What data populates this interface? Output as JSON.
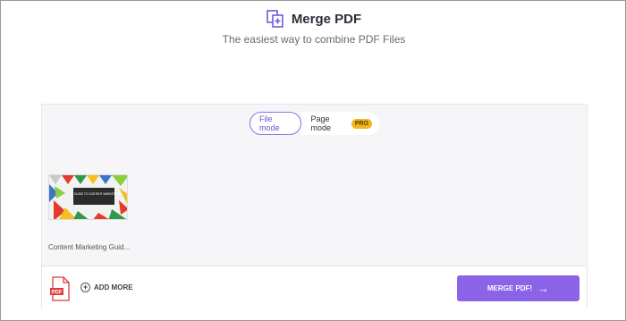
{
  "header": {
    "title": "Merge PDF",
    "subtitle": "The easiest way to combine PDF Files",
    "logo_icon": "merge-pages-icon",
    "accent": "#6b4fd8"
  },
  "mode_toggle": {
    "file_mode_label": "File mode",
    "page_mode_label": "Page mode",
    "pro_badge": "PRO",
    "selected": "File mode"
  },
  "files": [
    {
      "name": "Content Marketing Guid...",
      "thumbnail_text": "THE GUIDE TO CONTENT MARKETING"
    }
  ],
  "footer": {
    "pdf_icon_label": "PDF",
    "add_more_label": "ADD MORE",
    "merge_button_label": "MERGE PDF!",
    "merge_button_color": "#8a63e6"
  }
}
